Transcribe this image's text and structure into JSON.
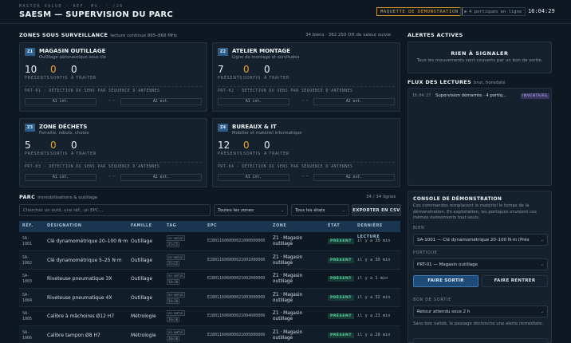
{
  "header": {
    "kicker": "MASTER VALUE · REF. MV. · /26",
    "title": "SAESM — SUPERVISION DU PARC",
    "demo_badge": "MAQUETTE DE DÉMONSTRATION",
    "portals_badge": "4 portiques en ligne",
    "clock": "16:04:29"
  },
  "zones_section": {
    "title": "ZONES SOUS SURVEILLANCE",
    "subtitle": "lecture continue 865–868 MHz",
    "summary": "34 biens · 382 250 DH de valeur suivie",
    "stat_labels": {
      "present": "PRÉSENTS",
      "out": "SORTIS",
      "todo": "À TRAITER"
    },
    "zones": [
      {
        "code": "Z1",
        "name": "MAGASIN OUTILLAGE",
        "desc": "Outillage aéronautique sous clé",
        "present": "10",
        "out": "0",
        "todo": "0",
        "portal": "PRT-01 · DÉTECTION DU SENS PAR SÉQUENCE D'ANTENNES",
        "ant_in": "A1 int.",
        "ant_out": "A2 ext.",
        "sep": "→ ←"
      },
      {
        "code": "Z2",
        "name": "ATELIER MONTAGE",
        "desc": "Ligne de montage et servitudes",
        "present": "7",
        "out": "0",
        "todo": "0",
        "portal": "PRT-02 · DÉTECTION DU SENS PAR SÉQUENCE D'ANTENNES",
        "ant_in": "A1 int.",
        "ant_out": "A2 ext.",
        "sep": "→ ←"
      },
      {
        "code": "Z3",
        "name": "ZONE DÉCHETS",
        "desc": "Ferraille, rebuts, chutes",
        "present": "5",
        "out": "0",
        "todo": "0",
        "portal": "PRT-03 · DÉTECTION DU SENS PAR SÉQUENCE D'ANTENNES",
        "ant_in": "A1 int.",
        "ant_out": "A2 ext.",
        "sep": "→ ←"
      },
      {
        "code": "Z4",
        "name": "BUREAUX & IT",
        "desc": "Mobilier et matériel informatique",
        "present": "12",
        "out": "0",
        "todo": "0",
        "portal": "PRT-04 · DÉTECTION DU SENS PAR SÉQUENCE D'ANTENNES",
        "ant_in": "A1 int.",
        "ant_out": "A2 ext.",
        "sep": "→ ←"
      }
    ]
  },
  "parc": {
    "title": "PARC",
    "subtitle": "immobilisations & outillage",
    "count": "34 / 34 lignes",
    "search_placeholder": "Chercher un outil, une réf., un EPC…",
    "zone_filter": "Toutes les zones",
    "state_filter": "Tous les états",
    "export_label": "EXPORTER EN CSV",
    "columns": [
      "RÉF.",
      "DÉSIGNATION",
      "FAMILLE",
      "TAG",
      "EPC",
      "ZONE",
      "ÉTAT",
      "DERNIÈRE LECTURE"
    ],
    "rows": [
      {
        "ref1": "SA-",
        "ref2": "1001",
        "name": "Clé dynamométrique 20–100 N·m",
        "family": "Outillage",
        "tag1": "on-metal",
        "tag2": "25×15",
        "epc": "E28011606000021000000000",
        "zone1": "Z1 · Magasin",
        "zone2": "outillage",
        "state": "PRÉSENT",
        "last": "il y a 30 min"
      },
      {
        "ref1": "SA-",
        "ref2": "1002",
        "name": "Clé dynamométrique 5–25 N·m",
        "family": "Outillage",
        "tag1": "on-metal",
        "tag2": "25×15",
        "epc": "E28011606000021001000000",
        "zone1": "Z1 · Magasin",
        "zone2": "outillage",
        "state": "PRÉSENT",
        "last": "il y a 30 min"
      },
      {
        "ref1": "SA-",
        "ref2": "1003",
        "name": "Riveteuse pneumatique 3X",
        "family": "Outillage",
        "tag1": "on-metal",
        "tag2": "50×30",
        "epc": "E28011606000021002000000",
        "zone1": "Z1 · Magasin",
        "zone2": "outillage",
        "state": "PRÉSENT",
        "last": "il y a 1 min"
      },
      {
        "ref1": "SA-",
        "ref2": "1004",
        "name": "Riveteuse pneumatique 4X",
        "family": "Outillage",
        "tag1": "on-metal",
        "tag2": "50×30",
        "epc": "E28011606000021003000000",
        "zone1": "Z1 · Magasin",
        "zone2": "outillage",
        "state": "PRÉSENT",
        "last": "il y a 32 min"
      },
      {
        "ref1": "SA-",
        "ref2": "1005",
        "name": "Calibre à mâchoires Ø12 H7",
        "family": "Métrologie",
        "tag1": "on-metal",
        "tag2": "20×10",
        "epc": "E28011606000021004000000",
        "zone1": "Z1 · Magasin",
        "zone2": "outillage",
        "state": "PRÉSENT",
        "last": "il y a 23 min"
      },
      {
        "ref1": "SA-",
        "ref2": "1006",
        "name": "Calibre tampon Ø8 H7",
        "family": "Métrologie",
        "tag1": "on-metal",
        "tag2": "20×10",
        "epc": "E28011606000021005000000",
        "zone1": "Z1 · Magasin",
        "zone2": "outillage",
        "state": "PRÉSENT",
        "last": "il y a 28 min"
      }
    ]
  },
  "alerts": {
    "title": "ALERTES ACTIVES",
    "empty_title": "RIEN À SIGNALER",
    "empty_text": "Tous les mouvements sont couverts par un bon de sortie."
  },
  "flux": {
    "title": "FLUX DES LECTURES",
    "subtitle": "brut, horodaté",
    "entries": [
      {
        "time": "16:04:27",
        "text": "Supervision démarrée · 4 portiq…",
        "tag": "INVENTAIRE"
      }
    ]
  },
  "console": {
    "title": "CONSOLE DE DÉMONSTRATION",
    "desc": "Ces commandes remplacent le matériel le temps de la démonstration. En exploitation, les portiques envoient ces mêmes événements tout seuls.",
    "bien_label": "BIEN",
    "bien_value": "SA-1001 — Clé dynamométrique 20–100 N·m (Prés",
    "portal_label": "PORTIQUE",
    "portal_value": "PRT-01 — Magasin outillage",
    "btn_out": "FAIRE SORTIR",
    "btn_in": "FAIRE RENTRER",
    "bon_label": "BON DE SORTIE",
    "bon_value": "Retour attendu sous 2 h",
    "bon_note": "Sans bon validé, le passage déclenche une alerte immédiate."
  }
}
